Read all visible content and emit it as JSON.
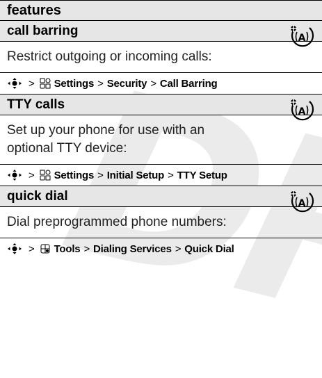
{
  "header": "features",
  "watermark": "DR",
  "sections": [
    {
      "title": "call barring",
      "description": "Restrict outgoing or incoming calls:",
      "path": {
        "icon": "settings-icon",
        "items": [
          "Settings",
          "Security",
          "Call Barring"
        ]
      }
    },
    {
      "title": "TTY calls",
      "description_lines": [
        "Set up your phone for use with an",
        "optional TTY device:"
      ],
      "path": {
        "icon": "settings-icon",
        "items": [
          "Settings",
          "Initial Setup",
          "TTY Setup"
        ]
      }
    },
    {
      "title": "quick dial",
      "description": "Dial preprogrammed phone numbers:",
      "path": {
        "icon": "tools-icon",
        "items": [
          "Tools",
          "Dialing Services",
          "Quick Dial"
        ]
      }
    }
  ],
  "separator": ">",
  "network_icon": "network-feature-icon"
}
